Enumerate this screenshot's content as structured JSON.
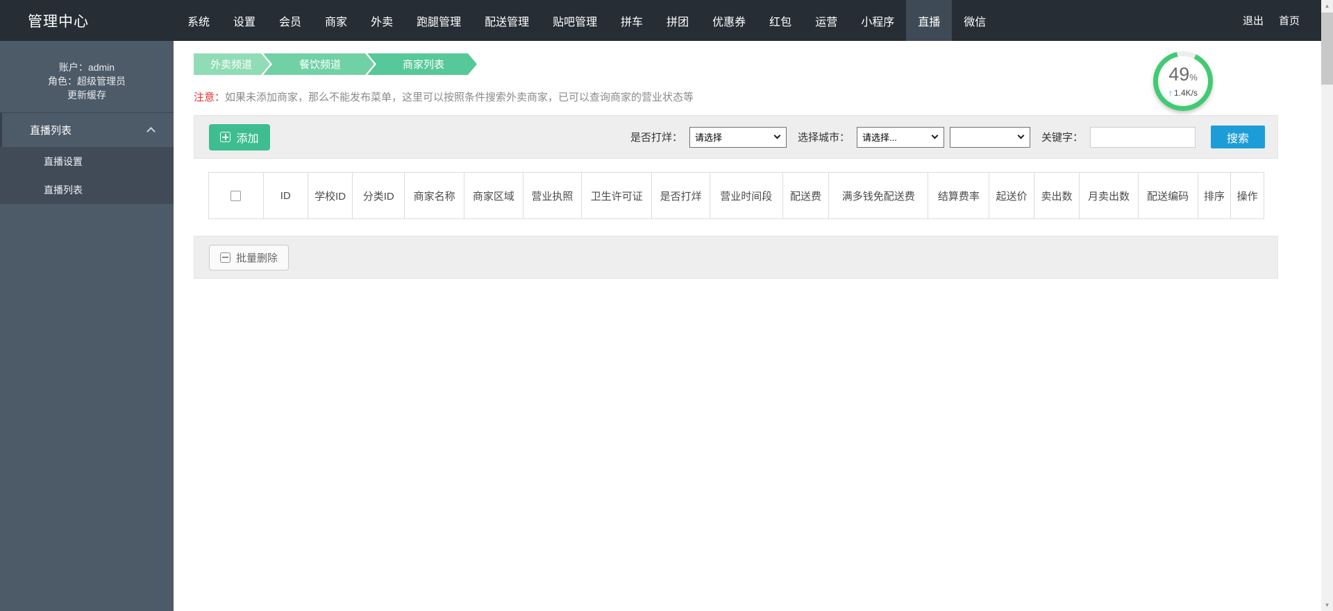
{
  "app": {
    "title": "管理中心"
  },
  "topnav": {
    "items": [
      {
        "label": "系统"
      },
      {
        "label": "设置"
      },
      {
        "label": "会员"
      },
      {
        "label": "商家"
      },
      {
        "label": "外卖"
      },
      {
        "label": "跑腿管理"
      },
      {
        "label": "配送管理"
      },
      {
        "label": "贴吧管理"
      },
      {
        "label": "拼车"
      },
      {
        "label": "拼团"
      },
      {
        "label": "优惠券"
      },
      {
        "label": "红包"
      },
      {
        "label": "运营"
      },
      {
        "label": "小程序"
      },
      {
        "label": "直播"
      },
      {
        "label": "微信"
      }
    ],
    "active_item": "直播",
    "logout": "退出",
    "home": "首页"
  },
  "sidebar": {
    "account": "账户：admin",
    "role": "角色：超级管理员",
    "refresh_cache": "更新缓存",
    "section": "直播列表",
    "submenu": [
      {
        "label": "直播设置"
      },
      {
        "label": "直播列表"
      }
    ]
  },
  "gauge": {
    "percent": "49",
    "unit": "%",
    "rate": "1.4K/s",
    "arrow": "↑"
  },
  "breadcrumb": [
    {
      "label": "外卖频道"
    },
    {
      "label": "餐饮频道"
    },
    {
      "label": "商家列表"
    }
  ],
  "notice": {
    "prefix": "注意：",
    "text": "如果未添加商家，那么不能发布菜单，这里可以按照条件搜索外卖商家，已可以查询商家的营业状态等"
  },
  "toolbar": {
    "add": "添加",
    "open_filter_label": "是否打烊：",
    "open_filter_value": "请选择",
    "city_filter_label": "选择城市：",
    "city_filter_value": "请选择...",
    "district_filter_value": "",
    "keyword_label": "关键字：",
    "keyword_value": "",
    "search": "搜索"
  },
  "table": {
    "headers": [
      "ID",
      "学校ID",
      "分类ID",
      "商家名称",
      "商家区域",
      "营业执照",
      "卫生许可证",
      "是否打烊",
      "营业时间段",
      "配送费",
      "满多钱免配送费",
      "结算费率",
      "起送价",
      "卖出数",
      "月卖出数",
      "配送编码",
      "排序",
      "操作"
    ]
  },
  "batch": {
    "delete": "批量删除"
  },
  "colors": {
    "accent_green": "#3dbd90",
    "accent_blue": "#1c9dd8",
    "notice_red": "#e62e2e",
    "gauge_green": "#41ca73",
    "nav_bg": "#262d35",
    "sidebar_bg": "#4d5a67"
  }
}
